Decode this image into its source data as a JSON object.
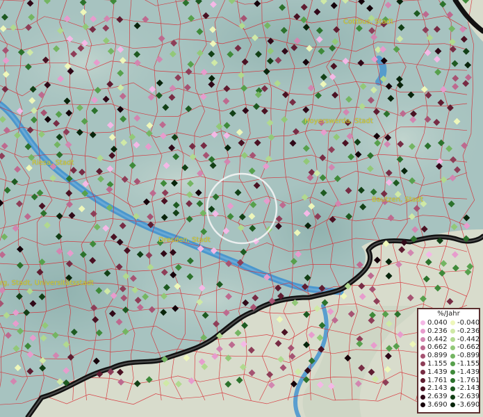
{
  "cities": [
    {
      "id": "cottbus",
      "name": "Cottbus, Stadt"
    },
    {
      "id": "hoyerswerda",
      "name": "Hoyerswerda, Stadt"
    },
    {
      "id": "riesa",
      "name": "Riesa, Stadt"
    },
    {
      "id": "bautzen",
      "name": "Bautzen, Stadt"
    },
    {
      "id": "dresden",
      "name": "Dresden, Stadt"
    },
    {
      "id": "freiberg",
      "name": "rg, Stadt, Universitätsstadt"
    }
  ],
  "legend": {
    "title": "%/Jahr",
    "positive": [
      {
        "label": "0.040",
        "color": "#f4b8e6"
      },
      {
        "label": "0.236",
        "color": "#e79ccd"
      },
      {
        "label": "0.442",
        "color": "#d286b0"
      },
      {
        "label": "0.662",
        "color": "#bd6a8f"
      },
      {
        "label": "0.899",
        "color": "#a65372"
      },
      {
        "label": "1.155",
        "color": "#8e3e58"
      },
      {
        "label": "1.439",
        "color": "#772c44"
      },
      {
        "label": "1.761",
        "color": "#5f1d31"
      },
      {
        "label": "2.143",
        "color": "#4a1223"
      },
      {
        "label": "2.639",
        "color": "#300918"
      },
      {
        "label": "3.690",
        "color": "#15030a"
      }
    ],
    "negative": [
      {
        "label": "-0.040",
        "color": "#eef7ba"
      },
      {
        "label": "-0.236",
        "color": "#cfe9a6"
      },
      {
        "label": "-0.442",
        "color": "#b1d98f"
      },
      {
        "label": "-0.662",
        "color": "#92c878"
      },
      {
        "label": "-0.899",
        "color": "#74b562"
      },
      {
        "label": "-1.155",
        "color": "#57a04c"
      },
      {
        "label": "-1.439",
        "color": "#3f8a3a"
      },
      {
        "label": "-1.761",
        "color": "#2c722c"
      },
      {
        "label": "-2.143",
        "color": "#1e5a21"
      },
      {
        "label": "-2.639",
        "color": "#124016"
      },
      {
        "label": "-3.690",
        "color": "#08240b"
      }
    ]
  },
  "colors": {
    "land": "#a7c3c0",
    "river": "#3b8fd0",
    "border": "#d7262e",
    "highlands": "#d8dccc",
    "national_border": "#111111",
    "selection_ring": "#f4f4f4"
  }
}
